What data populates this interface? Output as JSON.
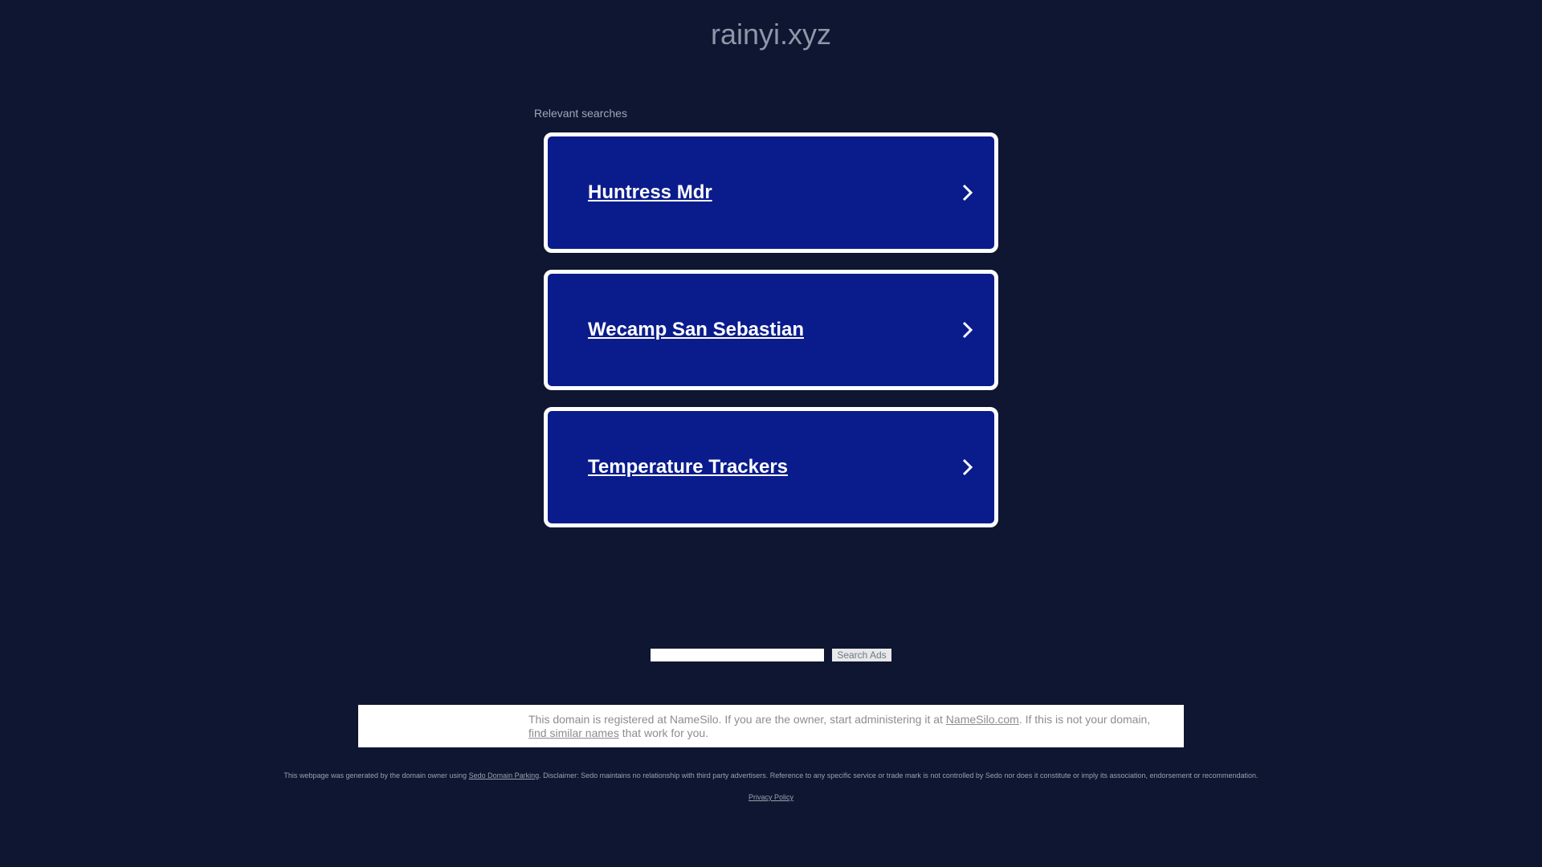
{
  "header": {
    "domain": "rainyi.xyz"
  },
  "related": {
    "label": "Relevant searches",
    "items": [
      {
        "label": "Huntress Mdr"
      },
      {
        "label": "Wecamp San Sebastian"
      },
      {
        "label": "Temperature Trackers"
      }
    ]
  },
  "search": {
    "value": "",
    "button_label": "Search Ads"
  },
  "info": {
    "text_1": "This domain is registered at NameSilo. If you are the owner, start administering it at ",
    "link_namesilo": "NameSilo.com",
    "text_2": ". If this is not your domain, ",
    "link_similar": "find similar names",
    "text_3": " that work for you."
  },
  "footer": {
    "disclaimer_1": "This webpage was generated by the domain owner using ",
    "disclaimer_link": "Sedo Domain Parking",
    "disclaimer_2": ". Disclaimer: Sedo maintains no relationship with third party advertisers. Reference to any specific service or trade mark is not controlled by Sedo nor does it constitute or imply its association, endorsement or recommendation.",
    "privacy_label": "Privacy Policy"
  },
  "colors": {
    "background": "#0e1631",
    "card_fill": "#0a1c8c",
    "card_border": "#ffffff"
  }
}
